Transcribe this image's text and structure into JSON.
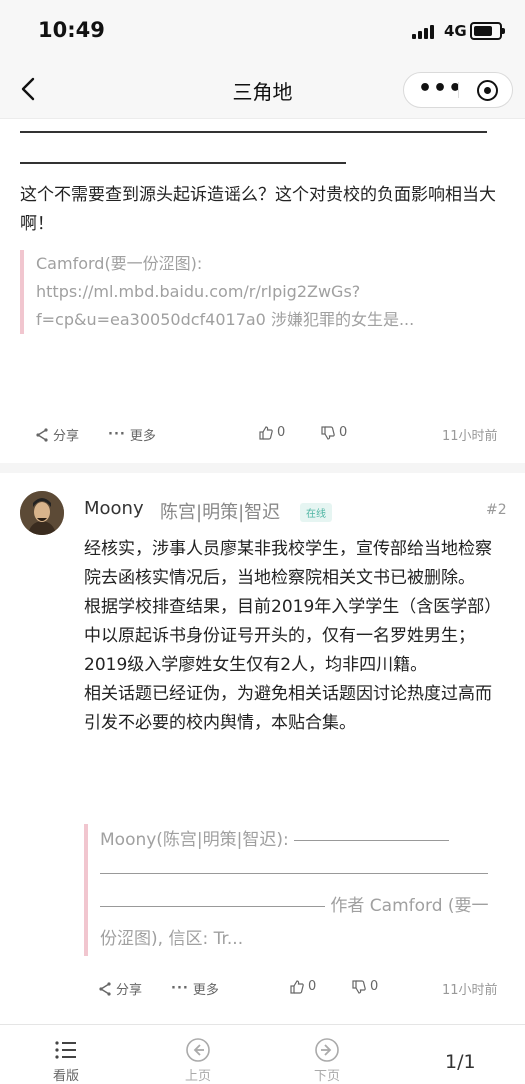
{
  "status_bar": {
    "time": "10:49",
    "network": "4G"
  },
  "nav": {
    "title": "三角地"
  },
  "post1": {
    "text": "这个不需要查到源头起诉造谣么？这个对贵校的负面影响相当大啊！",
    "quote": "Camford(要一份涩图): https://ml.mbd.baidu.com/r/rIpig2ZwGs?f=cp&u=ea30050dcf4017a0 涉嫌犯罪的女生是...",
    "share": "分享",
    "more": "更多",
    "likes": "0",
    "dislikes": "0",
    "time_ago": "11小时前"
  },
  "post2": {
    "author": "Moony",
    "groups": "陈宫|明策|智迟",
    "online": "在线",
    "floor": "#2",
    "paragraphs": [
      "经核实，涉事人员廖某非我校学生，宣传部给当地检察院去函核实情况后，当地检察院相关文书已被删除。",
      "根据学校排查结果，目前2019年入学学生（含医学部）中以原起诉书身份证号开头的，仅有一名罗姓男生；2019级入学廖姓女生仅有2人，均非四川籍。",
      "相关话题已经证伪，为避免相关话题因讨论热度过高而引发不必要的校内舆情，本贴合集。"
    ],
    "quote_head": "Moony(陈宫|明策|智迟): ",
    "quote_tail": " 作者 Camford (要一份涩图), 信区: Tr...",
    "share": "分享",
    "more": "更多",
    "likes": "0",
    "dislikes": "0",
    "time_ago": "11小时前"
  },
  "tabbar": {
    "board": "看版",
    "prev": "上页",
    "next": "下页",
    "page": "1/1"
  }
}
